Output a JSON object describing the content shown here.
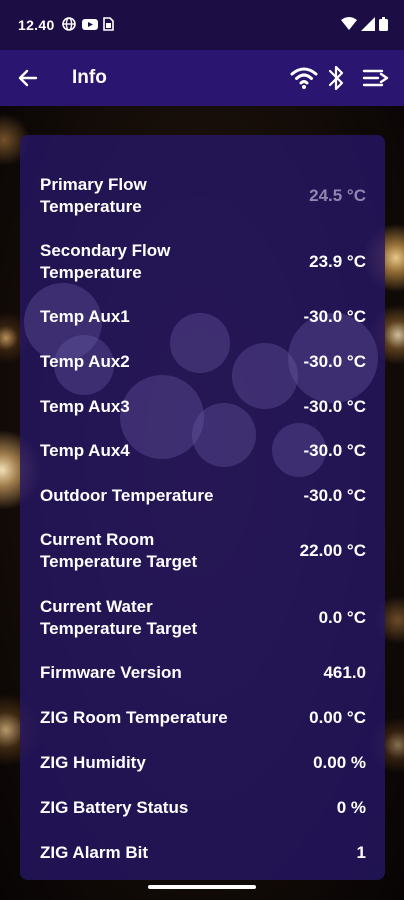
{
  "status_bar": {
    "time": "12.40",
    "icons_left": [
      "network-icon",
      "youtube-icon",
      "sim-icon"
    ],
    "icons_right": [
      "wifi-icon",
      "signal-icon",
      "battery-icon"
    ]
  },
  "app_bar": {
    "title": "Info",
    "actions": [
      "back-arrow-icon",
      "wifi-icon",
      "bluetooth-icon",
      "menu-icon"
    ]
  },
  "info_rows": [
    {
      "label": "Primary Flow Temperature",
      "value": "24.5 °C",
      "muted": true
    },
    {
      "label": "Secondary Flow Temperature",
      "value": "23.9 °C",
      "muted": false
    },
    {
      "label": "Temp Aux1",
      "value": "-30.0 °C",
      "muted": false
    },
    {
      "label": "Temp Aux2",
      "value": "-30.0 °C",
      "muted": false
    },
    {
      "label": "Temp Aux3",
      "value": "-30.0 °C",
      "muted": false
    },
    {
      "label": "Temp Aux4",
      "value": "-30.0 °C",
      "muted": false
    },
    {
      "label": "Outdoor Temperature",
      "value": "-30.0 °C",
      "muted": false
    },
    {
      "label": "Current Room Temperature Target",
      "value": "22.00 °C",
      "muted": false
    },
    {
      "label": "Current Water Temperature Target",
      "value": "0.0 °C",
      "muted": false
    },
    {
      "label": "Firmware Version",
      "value": "461.0",
      "muted": false
    },
    {
      "label": "ZIG Room Temperature",
      "value": "0.00 °C",
      "muted": false
    },
    {
      "label": "ZIG Humidity",
      "value": "0.00 %",
      "muted": false
    },
    {
      "label": "ZIG Battery Status",
      "value": "0 %",
      "muted": false
    },
    {
      "label": "ZIG Alarm Bit",
      "value": "1",
      "muted": false
    }
  ],
  "colors": {
    "status_bar_bg": "#1c0e44",
    "app_bar_bg": "#2a1670",
    "card_bg": "#261664",
    "text": "#ffffff",
    "muted_text": "#8e86b0"
  }
}
